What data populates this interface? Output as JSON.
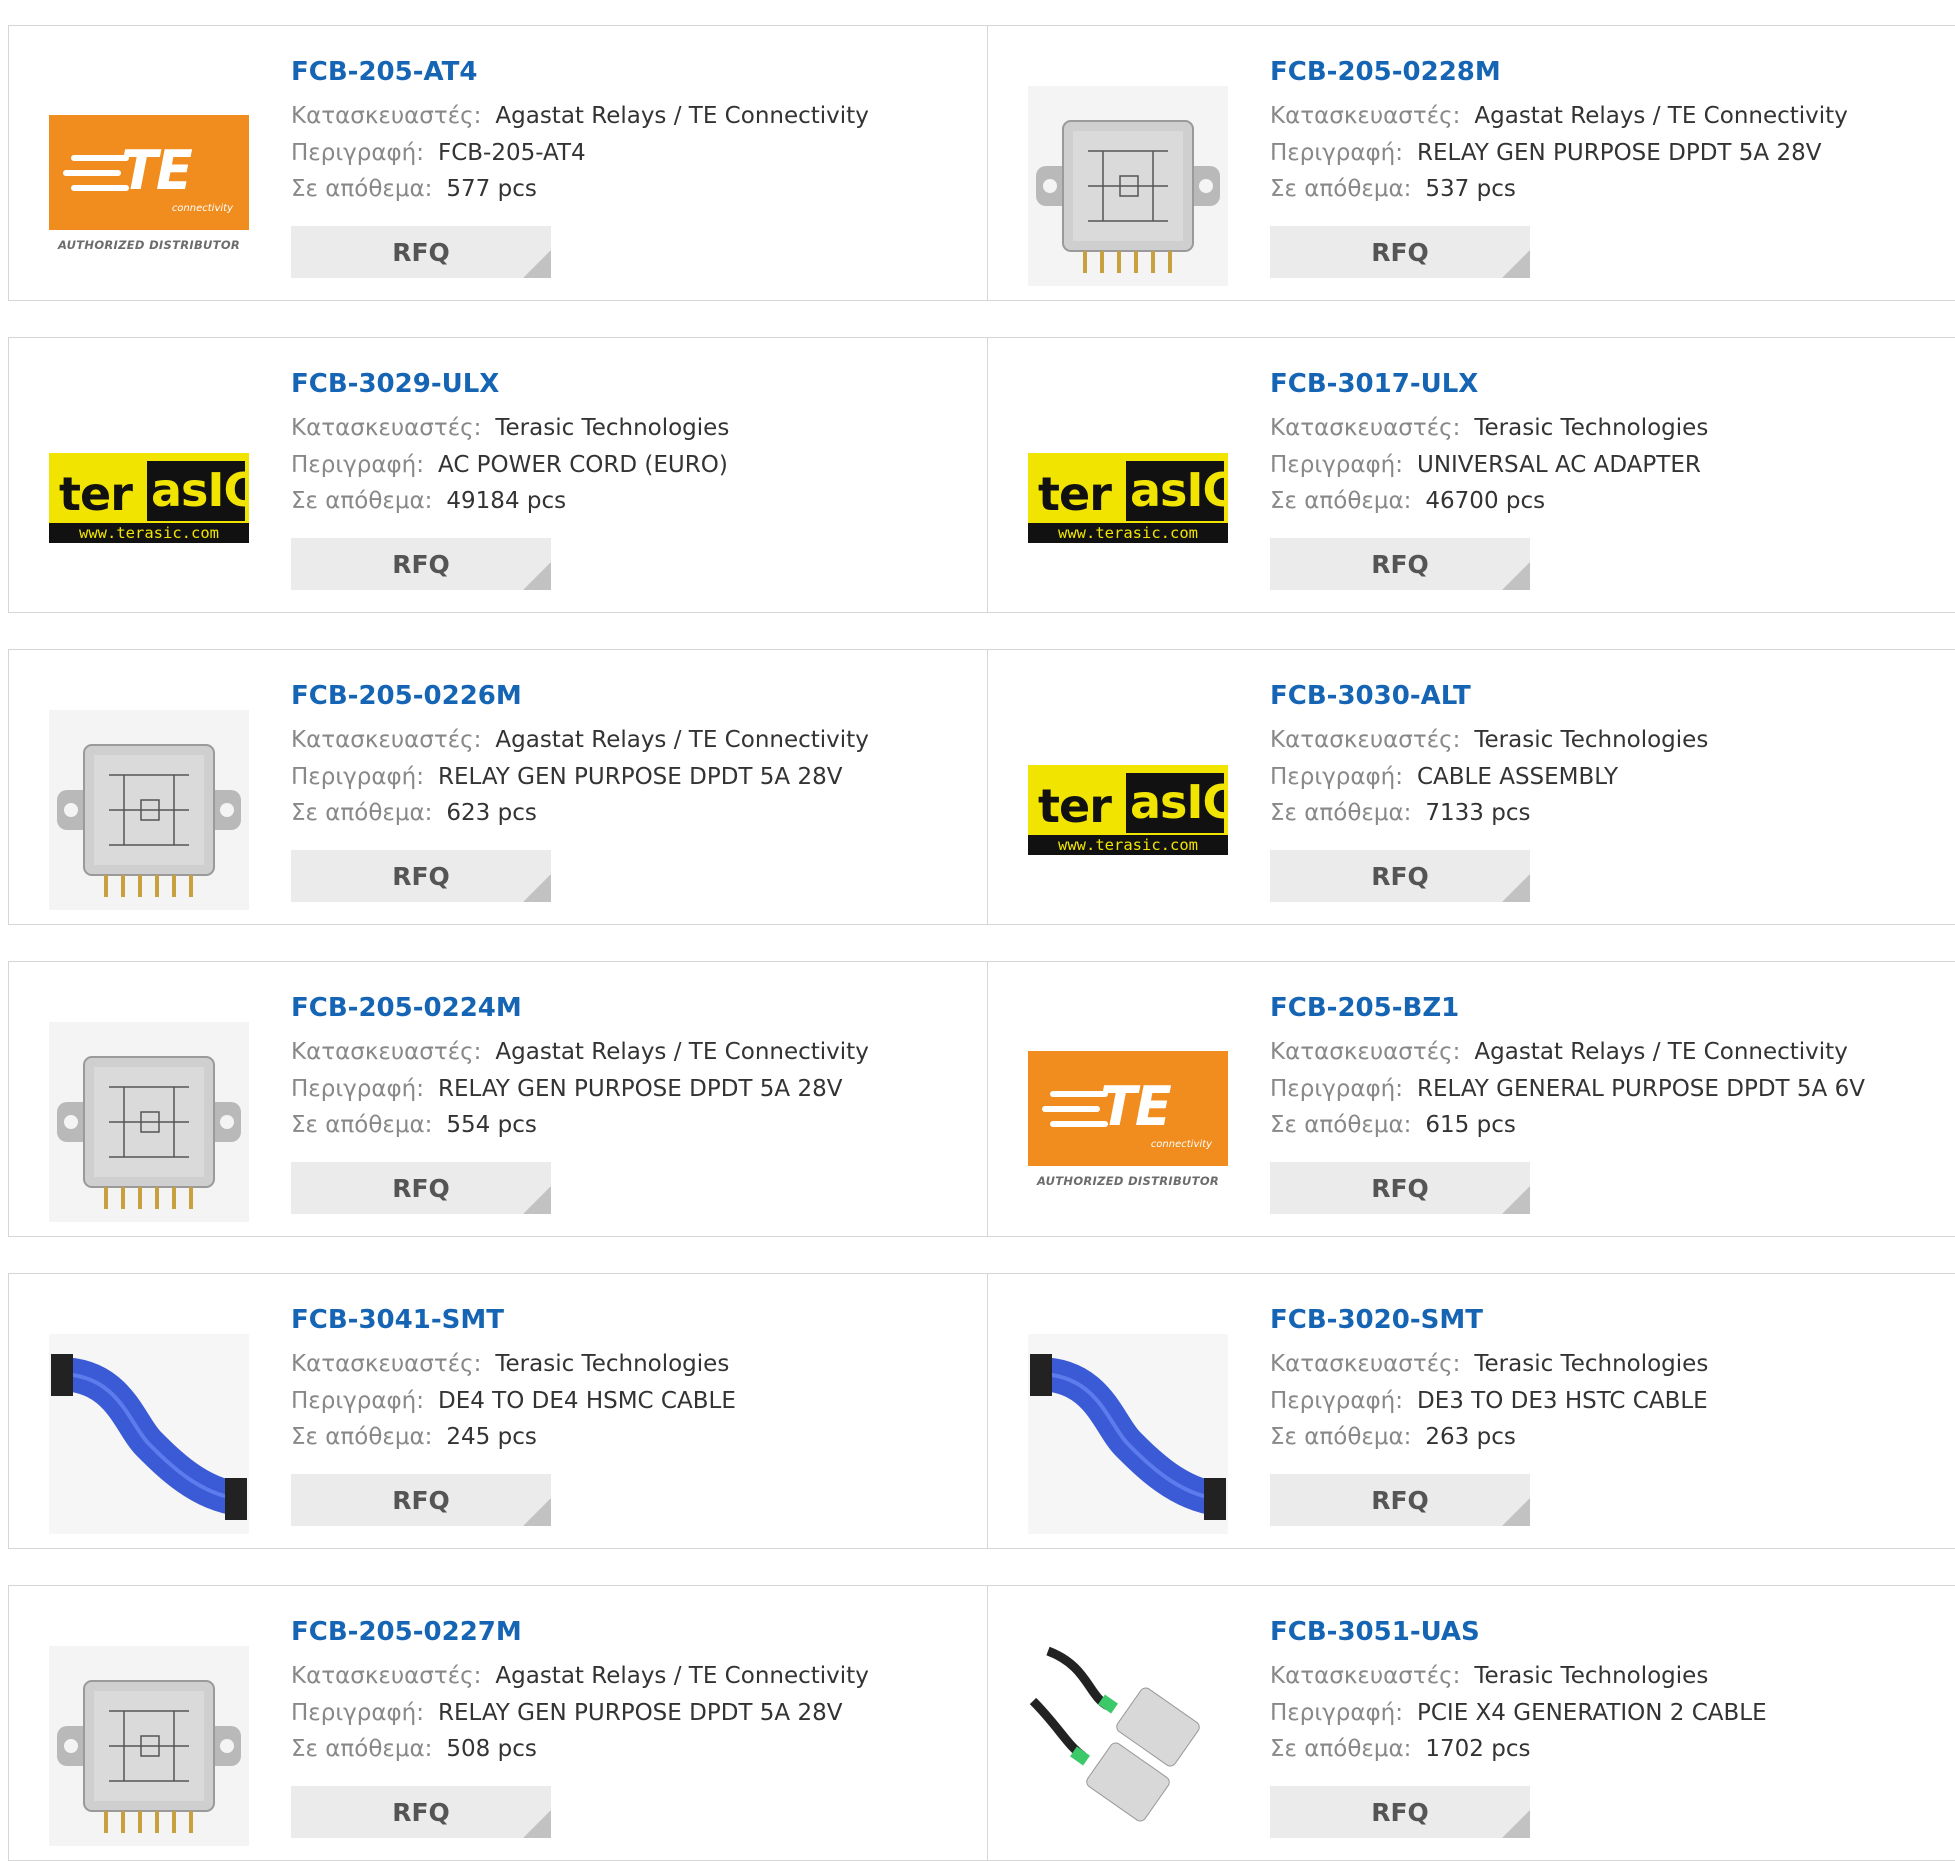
{
  "labels": {
    "manufacturer": "Κατασκευαστές:",
    "description": "Περιγραφή:",
    "stock": "Σε απόθεμα:",
    "rfq": "RFQ"
  },
  "colors": {
    "title_link": "#1565b4",
    "te_orange": "#f18d1e",
    "terasic_yellow": "#f1e400",
    "rfq_bg": "#ebebeb"
  },
  "products": [
    {
      "part": "FCB-205-AT4",
      "manufacturer": "Agastat Relays / TE Connectivity",
      "description": "FCB-205-AT4",
      "stock": "577 pcs",
      "image": "te-connectivity-logo"
    },
    {
      "part": "FCB-205-0228M",
      "manufacturer": "Agastat Relays / TE Connectivity",
      "description": "RELAY GEN PURPOSE DPDT 5A 28V",
      "stock": "537 pcs",
      "image": "relay-photo"
    },
    {
      "part": "FCB-3029-ULX",
      "manufacturer": "Terasic Technologies",
      "description": "AC POWER CORD (EURO)",
      "stock": "49184 pcs",
      "image": "terasic-logo"
    },
    {
      "part": "FCB-3017-ULX",
      "manufacturer": "Terasic Technologies",
      "description": "UNIVERSAL AC ADAPTER",
      "stock": "46700 pcs",
      "image": "terasic-logo"
    },
    {
      "part": "FCB-205-0226M",
      "manufacturer": "Agastat Relays / TE Connectivity",
      "description": "RELAY GEN PURPOSE DPDT 5A 28V",
      "stock": "623 pcs",
      "image": "relay-photo"
    },
    {
      "part": "FCB-3030-ALT",
      "manufacturer": "Terasic Technologies",
      "description": "CABLE ASSEMBLY",
      "stock": "7133 pcs",
      "image": "terasic-logo"
    },
    {
      "part": "FCB-205-0224M",
      "manufacturer": "Agastat Relays / TE Connectivity",
      "description": "RELAY GEN PURPOSE DPDT 5A 28V",
      "stock": "554 pcs",
      "image": "relay-photo"
    },
    {
      "part": "FCB-205-BZ1",
      "manufacturer": "Agastat Relays / TE Connectivity",
      "description": "RELAY GENERAL PURPOSE DPDT 5A 6V",
      "stock": "615 pcs",
      "image": "te-connectivity-logo"
    },
    {
      "part": "FCB-3041-SMT",
      "manufacturer": "Terasic Technologies",
      "description": "DE4 TO DE4 HSMC CABLE",
      "stock": "245 pcs",
      "image": "ribbon-cable-photo"
    },
    {
      "part": "FCB-3020-SMT",
      "manufacturer": "Terasic Technologies",
      "description": "DE3 TO DE3 HSTC CABLE",
      "stock": "263 pcs",
      "image": "ribbon-cable-photo"
    },
    {
      "part": "FCB-205-0227M",
      "manufacturer": "Agastat Relays / TE Connectivity",
      "description": "RELAY GEN PURPOSE DPDT 5A 28V",
      "stock": "508 pcs",
      "image": "relay-photo"
    },
    {
      "part": "FCB-3051-UAS",
      "manufacturer": "Terasic Technologies",
      "description": "PCIE X4 GENERATION 2 CABLE",
      "stock": "1702 pcs",
      "image": "pcie-cable-photo"
    }
  ],
  "logos": {
    "te_connectivity": {
      "mark": "TE",
      "sub": "connectivity",
      "tagline": "AUTHORIZED DISTRIBUTOR"
    },
    "terasic": {
      "left": "ter",
      "right": "asIC",
      "url": "www.terasic.com"
    }
  }
}
